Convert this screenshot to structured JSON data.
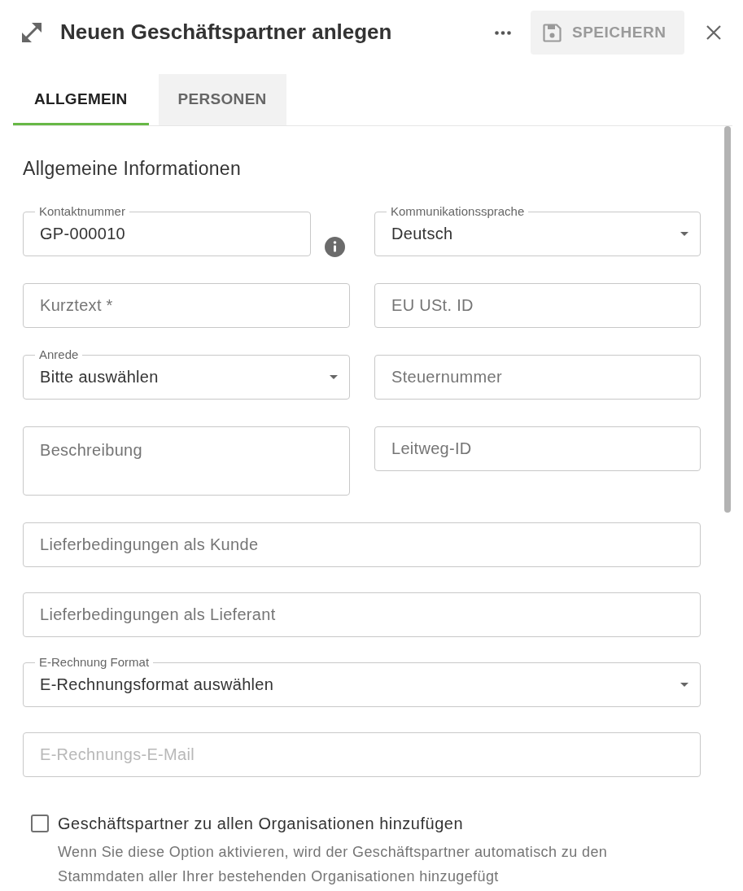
{
  "dialog": {
    "title": "Neuen Geschäftspartner anlegen",
    "save": {
      "label": "SPEICHERN",
      "disabled": true
    }
  },
  "tabs": [
    {
      "label": "ALLGEMEIN",
      "selected": true
    },
    {
      "label": "PERSONEN",
      "selected": false
    }
  ],
  "section_title": "Allgemeine Informationen",
  "fields": [
    {
      "kind": "text",
      "label": "Kontaktnummer",
      "value": "GP-000010",
      "info": true,
      "disabled": false
    },
    {
      "kind": "select",
      "label": "Kommunikationssprache",
      "value": "Deutsch",
      "info": false,
      "disabled": false
    },
    {
      "kind": "text",
      "placeholder": "Kurztext *",
      "info": false,
      "disabled": false
    },
    {
      "kind": "text",
      "placeholder": "EU USt. ID",
      "info": false,
      "disabled": false
    },
    {
      "kind": "select",
      "label": "Anrede",
      "value": "Bitte auswählen",
      "info": false,
      "disabled": false
    },
    {
      "kind": "text",
      "placeholder": "Steuernummer",
      "info": false,
      "disabled": false
    },
    {
      "kind": "textarea",
      "placeholder": "Beschreibung",
      "info": false,
      "disabled": false
    },
    {
      "kind": "text",
      "placeholder": "Leitweg-ID",
      "info": false,
      "disabled": false
    }
  ],
  "wide_fields": [
    {
      "kind": "text",
      "placeholder": "Lieferbedingungen als Kunde",
      "info": false,
      "disabled": false
    },
    {
      "kind": "text",
      "placeholder": "Lieferbedingungen als Lieferant",
      "info": false,
      "disabled": false
    },
    {
      "kind": "select",
      "label": "E-Rechnung Format",
      "value": "E-Rechnungsformat auswählen",
      "info": false,
      "disabled": false
    },
    {
      "kind": "text",
      "placeholder": "E-Rechnungs-E-Mail",
      "info": false,
      "disabled": true
    }
  ],
  "option": {
    "label": "Geschäftspartner zu allen Organisationen hinzufügen",
    "checked": false,
    "help": "Wenn Sie diese Option aktivieren, wird der Geschäftspartner automatisch zu den Stammdaten aller Ihrer bestehenden Organisationen hinzugefügt"
  }
}
